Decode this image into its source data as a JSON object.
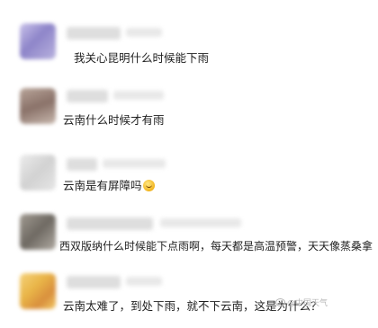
{
  "comments": [
    {
      "text": "我关心昆明什么时候能下雨",
      "avatar_color": "#8e85c9"
    },
    {
      "text": "云南什么时候才有雨",
      "avatar_color": "#8a7269"
    },
    {
      "text": "云南是有屏障吗",
      "avatar_color": "#d9d9d9"
    },
    {
      "text": "西双版纳什么时候能下点雨啊，每天都是高温预警，天天像蒸桑拿",
      "avatar_color": "#7a756e"
    },
    {
      "text": "云南太难了，到处下雨，就不下云南，这是为什么？",
      "avatar_color": "#e9b548"
    }
  ],
  "watermark": "@中国天气"
}
